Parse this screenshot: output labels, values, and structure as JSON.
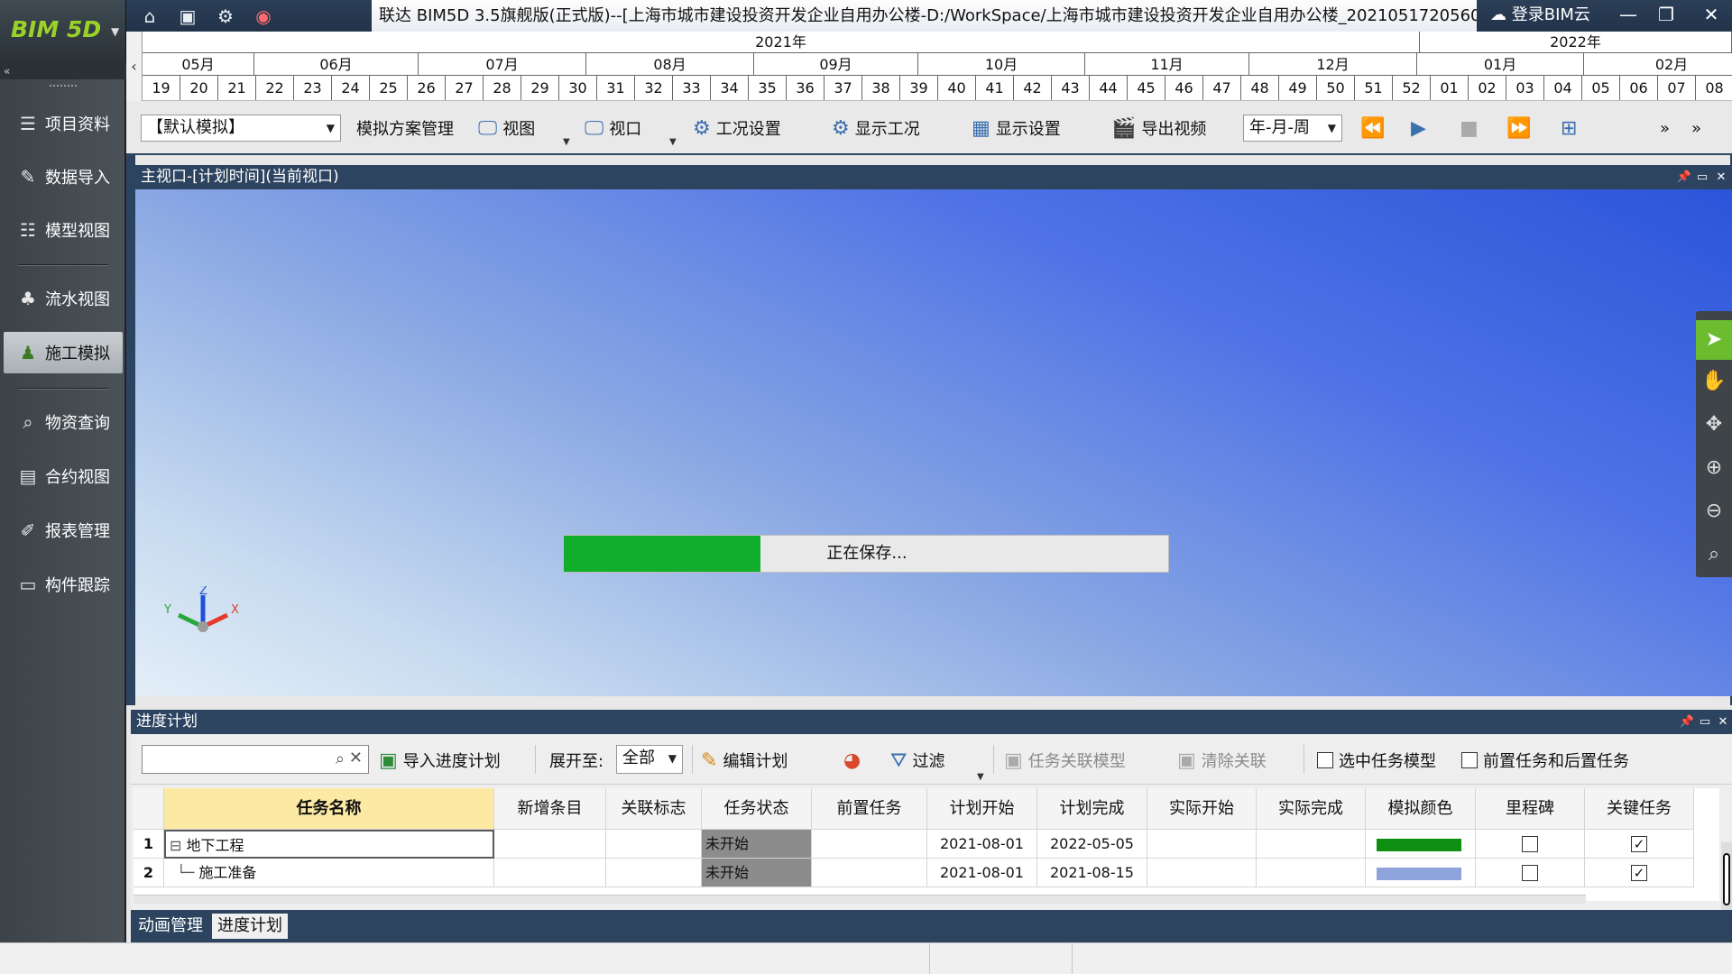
{
  "app": {
    "logo": "BIM 5D",
    "title": "联达 BIM5D 3.5旗舰版(正式版)--[上海市城市建设投资开发企业自用办公楼-D:/WorkSpace/上海市城市建设投资开发企业自用办公楼_2021051720560",
    "cloud_login": "登录BIM云"
  },
  "timeline": {
    "years": [
      "2021年",
      "2022年"
    ],
    "months": [
      "05月",
      "06月",
      "07月",
      "08月",
      "09月",
      "10月",
      "11月",
      "12月",
      "01月",
      "02月"
    ],
    "weeks": [
      "19",
      "20",
      "21",
      "22",
      "23",
      "24",
      "25",
      "26",
      "27",
      "28",
      "29",
      "30",
      "31",
      "32",
      "33",
      "34",
      "35",
      "36",
      "37",
      "38",
      "39",
      "40",
      "41",
      "42",
      "43",
      "44",
      "45",
      "46",
      "47",
      "48",
      "49",
      "50",
      "51",
      "52",
      "01",
      "02",
      "03",
      "04",
      "05",
      "06",
      "07",
      "08"
    ]
  },
  "sidebar": {
    "items": [
      {
        "label": "项目资料",
        "icon": "stack-icon"
      },
      {
        "label": "数据导入",
        "icon": "import-icon"
      },
      {
        "label": "模型视图",
        "icon": "layers-icon"
      },
      {
        "label": "流水视图",
        "icon": "flow-icon"
      },
      {
        "label": "施工模拟",
        "icon": "worker-icon",
        "active": true
      },
      {
        "label": "物资查询",
        "icon": "search-icon"
      },
      {
        "label": "合约视图",
        "icon": "contract-icon"
      },
      {
        "label": "报表管理",
        "icon": "report-icon"
      },
      {
        "label": "构件跟踪",
        "icon": "monitor-icon"
      }
    ]
  },
  "toolbar": {
    "scheme_select": "【默认模拟】",
    "scheme_manage": "模拟方案管理",
    "view": "视图",
    "viewport": "视口",
    "condition_settings": "工况设置",
    "show_condition": "显示工况",
    "display_settings": "显示设置",
    "export_video": "导出视频",
    "time_scale": "年-月-周"
  },
  "viewport": {
    "header": "主视口-[计划时间](当前视口)",
    "progress_text": "正在保存...",
    "progress_fraction": 0.325,
    "axis_x": "X",
    "axis_y": "Y",
    "axis_z": "Z"
  },
  "schedule": {
    "header": "进度计划",
    "import_plan": "导入进度计划",
    "expand_label": "展开至:",
    "expand_value": "全部",
    "edit_plan": "编辑计划",
    "filter": "过滤",
    "link_model": "任务关联模型",
    "clear_link": "清除关联",
    "select_task_model": "选中任务模型",
    "pre_post_tasks": "前置任务和后置任务",
    "columns": [
      "任务名称",
      "新增条目",
      "关联标志",
      "任务状态",
      "前置任务",
      "计划开始",
      "计划完成",
      "实际开始",
      "实际完成",
      "模拟颜色",
      "里程碑",
      "关键任务"
    ],
    "rows": [
      {
        "num": "1",
        "name": "地下工程",
        "status": "未开始",
        "plan_start": "2021-08-01",
        "plan_end": "2022-05-05",
        "color": "#0f8f12",
        "milestone": false,
        "critical": true
      },
      {
        "num": "2",
        "name": "施工准备",
        "status": "未开始",
        "plan_start": "2021-08-01",
        "plan_end": "2021-08-15",
        "color": "#8ea3dc",
        "milestone": false,
        "critical": true
      }
    ]
  },
  "bottom_tabs": [
    "动画管理",
    "进度计划"
  ],
  "colors": {
    "progress": "#11ae2c",
    "panel_header": "#2d4460",
    "nav_active": "#6dbb2f"
  }
}
